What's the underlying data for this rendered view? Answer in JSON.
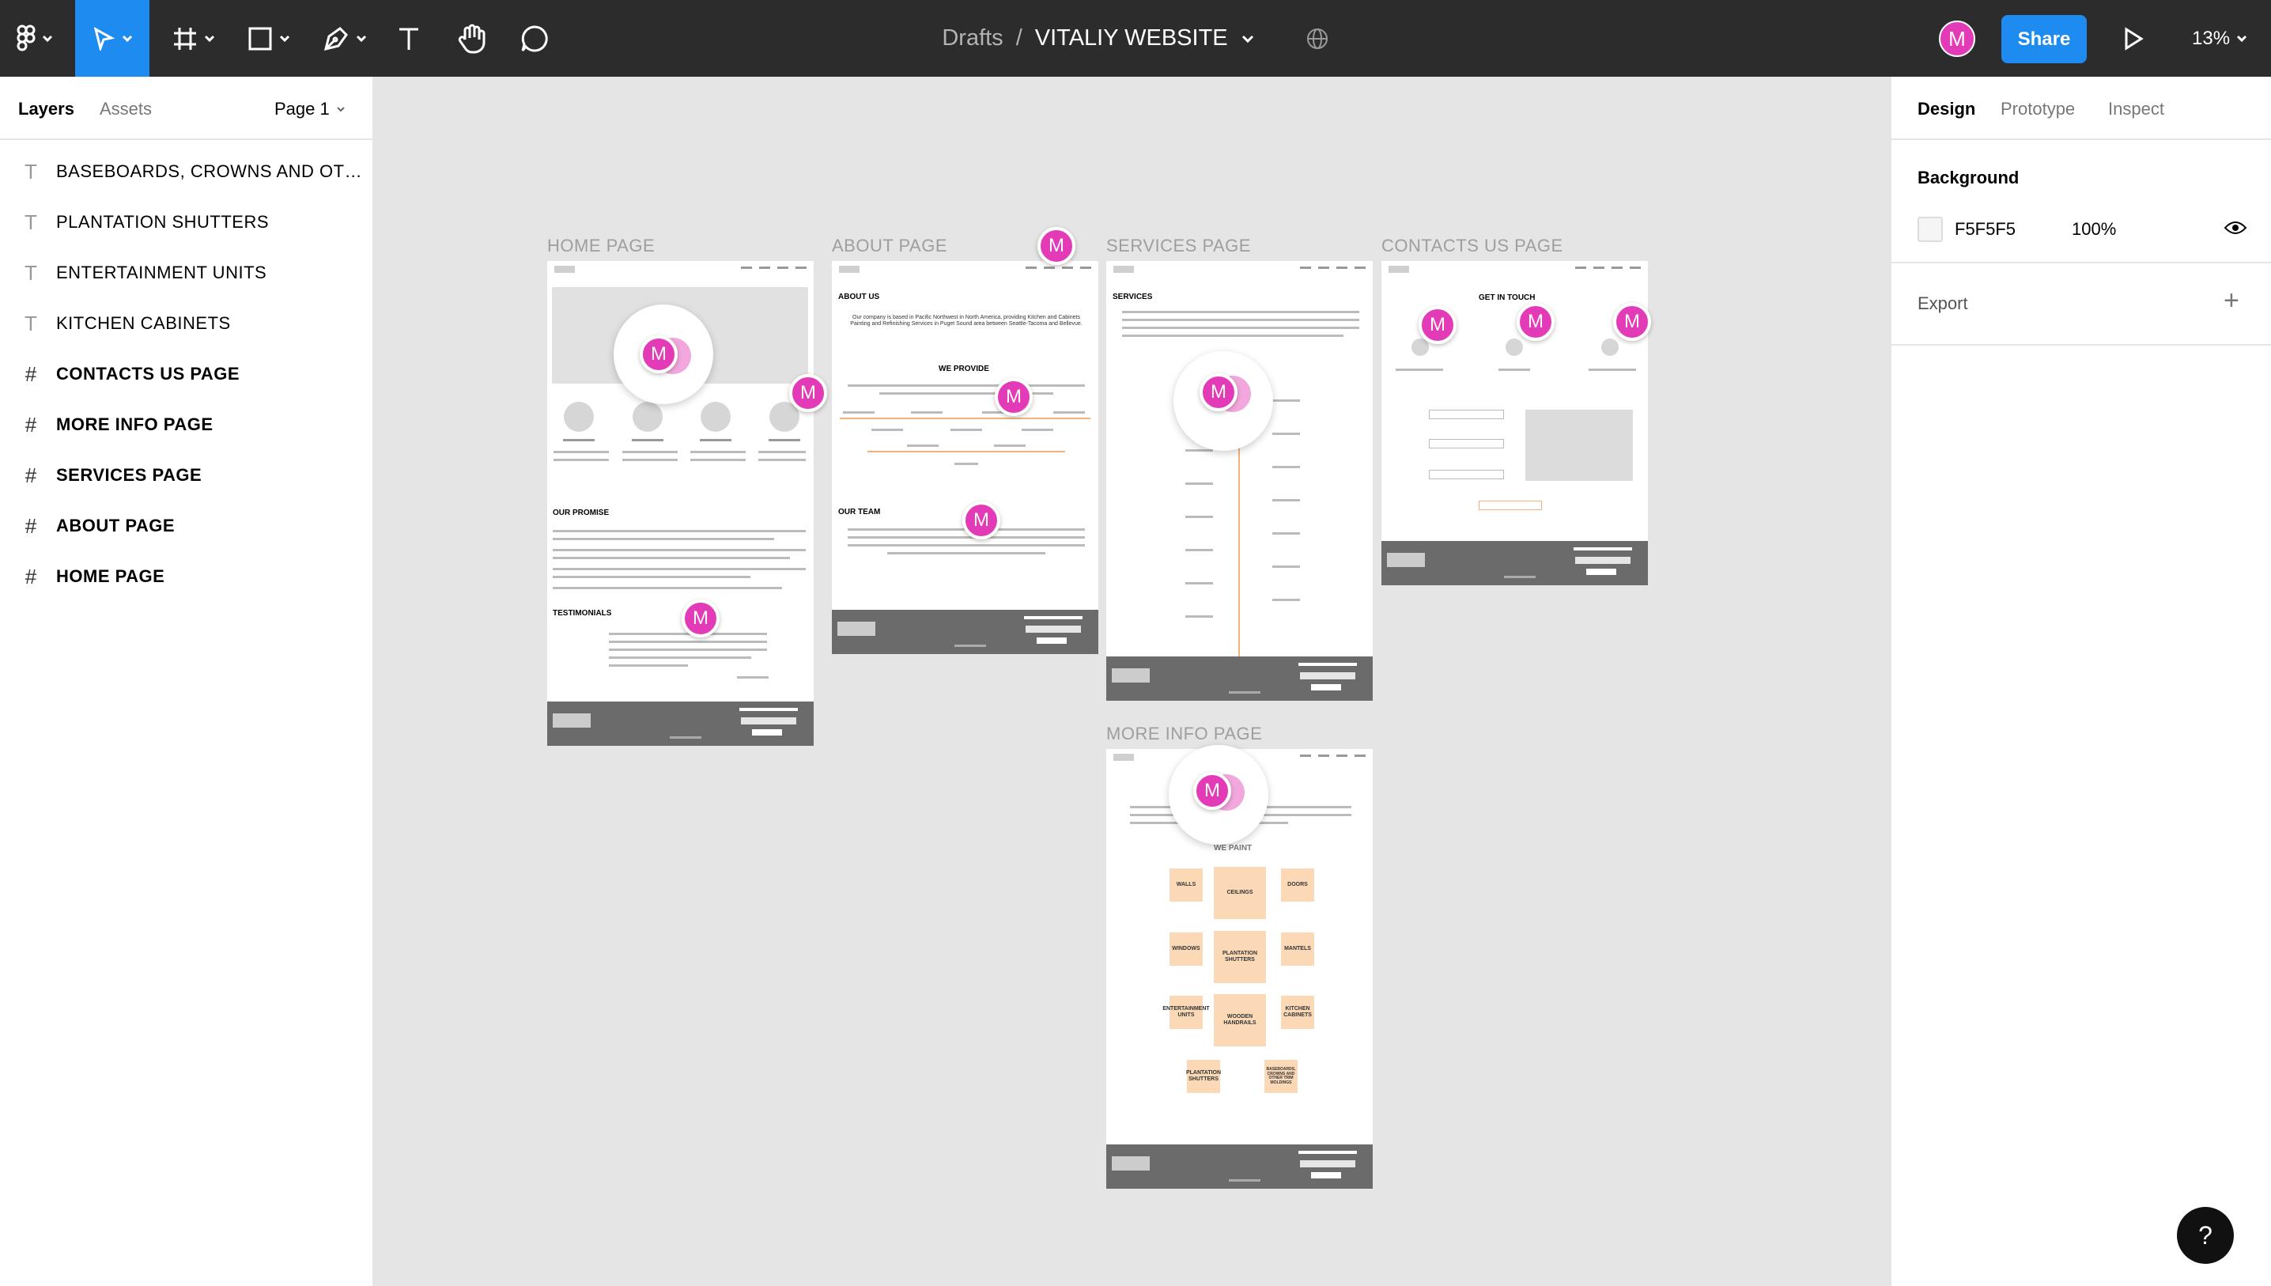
{
  "toolbar": {
    "breadcrumb_parent": "Drafts",
    "breadcrumb_sep": "/",
    "file_name": "VITALIY WEBSITE",
    "avatar_initial": "M",
    "share_label": "Share",
    "zoom": "13%",
    "icons": [
      "figma-logo-icon",
      "move-tool-icon",
      "frame-tool-icon",
      "shape-tool-icon",
      "pen-tool-icon",
      "text-tool-icon",
      "hand-tool-icon",
      "comment-tool-icon",
      "globe-icon",
      "play-icon"
    ]
  },
  "left_panel": {
    "tabs": [
      "Layers",
      "Assets"
    ],
    "page": "Page 1",
    "layers": [
      {
        "type": "text",
        "label": "BASEBOARDS, CROWNS AND OTH..."
      },
      {
        "type": "text",
        "label": "PLANTATION SHUTTERS"
      },
      {
        "type": "text",
        "label": "ENTERTAINMENT UNITS"
      },
      {
        "type": "text",
        "label": "KITCHEN CABINETS"
      },
      {
        "type": "frame",
        "label": "CONTACTS US PAGE"
      },
      {
        "type": "frame",
        "label": "MORE INFO PAGE"
      },
      {
        "type": "frame",
        "label": "SERVICES PAGE"
      },
      {
        "type": "frame",
        "label": "ABOUT PAGE"
      },
      {
        "type": "frame",
        "label": "HOME PAGE"
      }
    ]
  },
  "right_panel": {
    "tabs": [
      "Design",
      "Prototype",
      "Inspect"
    ],
    "background_title": "Background",
    "background_hex": "F5F5F5",
    "background_opacity": "100%",
    "export_title": "Export",
    "export_add": "+"
  },
  "canvas": {
    "frame_labels": {
      "home": "HOME PAGE",
      "about": "ABOUT PAGE",
      "services": "SERVICES PAGE",
      "contacts": "CONTACTS US PAGE",
      "moreinfo": "MORE INFO PAGE"
    },
    "home": {
      "promise": "OUR PROMISE",
      "testimonials": "TESTIMONIALS"
    },
    "about": {
      "about_us": "ABOUT US",
      "about_text": "Our company is based in Pacific Northwest in North America, providing Kitchen and Cabinets Painting and Refinishing Services in Puget Sound area between Seattle-Tacoma and Bellevue.",
      "we_provide": "WE PROVIDE",
      "our_team": "OUR TEAM"
    },
    "services": {
      "title": "SERVICES"
    },
    "contacts": {
      "title": "GET IN TOUCH"
    },
    "moreinfo": {
      "we_paint": "WE PAINT",
      "cards": [
        "WALLS",
        "CEILINGS",
        "DOORS",
        "WINDOWS",
        "PLANTATION SHUTTERS",
        "MANTELS",
        "ENTERTAINMENT UNITS",
        "WOODEN HANDRAILS",
        "KITCHEN CABINETS",
        "PLANTATION SHUTTERS",
        "BASEBOARDS, CROWNS AND OTHER TRIM MOLDINGS"
      ]
    },
    "cursor_initial": "M"
  },
  "help": {
    "label": "?"
  }
}
